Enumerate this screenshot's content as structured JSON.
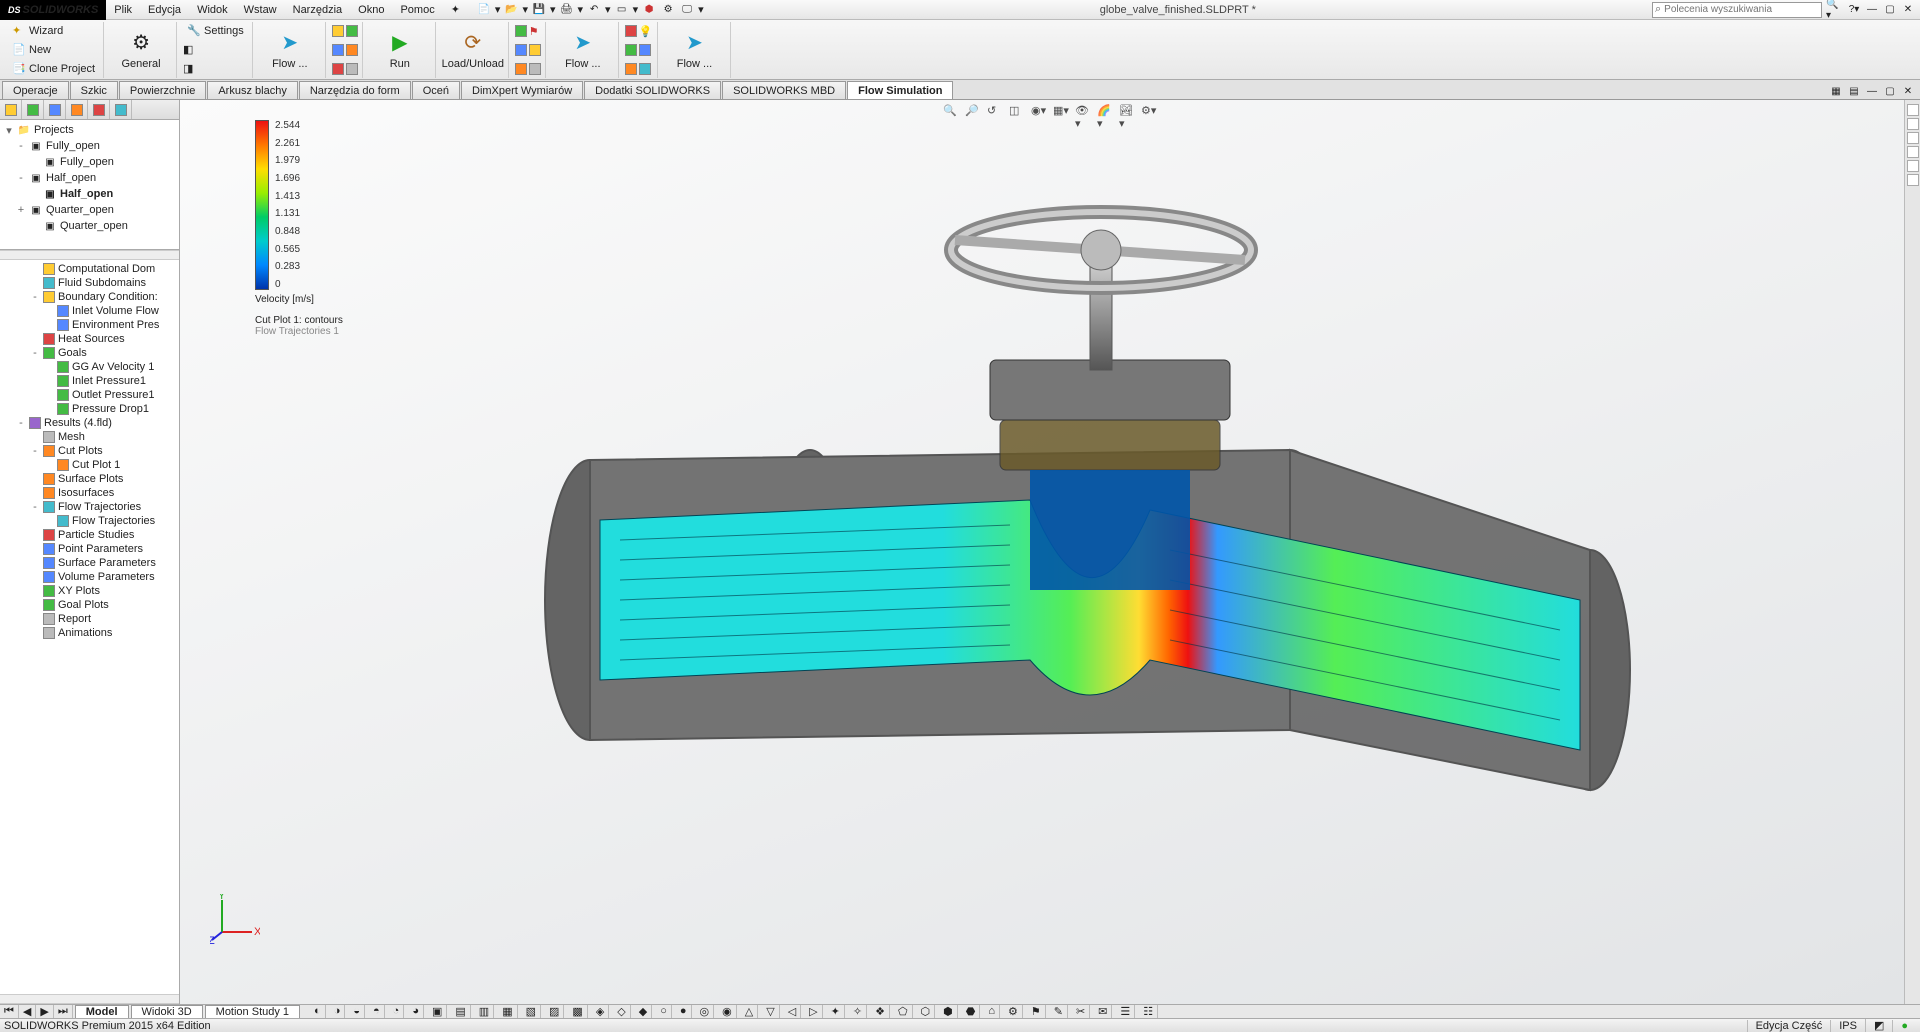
{
  "app": {
    "brand": "SOLIDWORKS",
    "title": "globe_valve_finished.SLDPRT *"
  },
  "menu": {
    "items": [
      "Plik",
      "Edycja",
      "Widok",
      "Wstaw",
      "Narzędzia",
      "Okno",
      "Pomoc"
    ]
  },
  "search": {
    "placeholder": "Polecenia wyszukiwania"
  },
  "ribbon": {
    "wizard": "Wizard",
    "new": "New",
    "clone": "Clone Project",
    "general": "General",
    "settings": "Settings",
    "flow": "Flow ...",
    "run": "Run",
    "loadunload": "Load/Unload",
    "flow2": "Flow ...",
    "flow3": "Flow ..."
  },
  "tabs": {
    "items": [
      "Operacje",
      "Szkic",
      "Powierzchnie",
      "Arkusz blachy",
      "Narzędzia do form",
      "Oceń",
      "DimXpert Wymiarów",
      "Dodatki SOLIDWORKS",
      "SOLIDWORKS MBD",
      "Flow Simulation"
    ],
    "active": 9
  },
  "tree1": {
    "root": "Projects",
    "items": [
      {
        "label": "Fully_open",
        "exp": "-",
        "lvl": 1
      },
      {
        "label": "Fully_open",
        "lvl": 2
      },
      {
        "label": "Half_open",
        "exp": "-",
        "lvl": 1
      },
      {
        "label": "Half_open",
        "lvl": 2,
        "bold": true
      },
      {
        "label": "Quarter_open",
        "exp": "+",
        "lvl": 1
      },
      {
        "label": "Quarter_open",
        "lvl": 2
      }
    ]
  },
  "tree2": {
    "items": [
      {
        "label": "Computational Dom",
        "lvl": 1,
        "ico": "c-yel"
      },
      {
        "label": "Fluid Subdomains",
        "lvl": 1,
        "ico": "c-cyan"
      },
      {
        "label": "Boundary Condition:",
        "lvl": 1,
        "exp": "-",
        "ico": "c-yel"
      },
      {
        "label": "Inlet Volume Flow",
        "lvl": 2,
        "ico": "c-blu"
      },
      {
        "label": "Environment Pres",
        "lvl": 2,
        "ico": "c-blu"
      },
      {
        "label": "Heat Sources",
        "lvl": 1,
        "ico": "c-red"
      },
      {
        "label": "Goals",
        "lvl": 1,
        "exp": "-",
        "ico": "c-grn"
      },
      {
        "label": "GG Av Velocity 1",
        "lvl": 2,
        "ico": "c-grn"
      },
      {
        "label": "Inlet Pressure1",
        "lvl": 2,
        "ico": "c-grn"
      },
      {
        "label": "Outlet Pressure1",
        "lvl": 2,
        "ico": "c-grn"
      },
      {
        "label": "Pressure Drop1",
        "lvl": 2,
        "ico": "c-grn"
      },
      {
        "label": "Results (4.fld)",
        "lvl": 0,
        "exp": "-",
        "ico": "c-purp"
      },
      {
        "label": "Mesh",
        "lvl": 1,
        "ico": "c-gray"
      },
      {
        "label": "Cut Plots",
        "lvl": 1,
        "exp": "-",
        "ico": "c-org"
      },
      {
        "label": "Cut Plot 1",
        "lvl": 2,
        "ico": "c-org"
      },
      {
        "label": "Surface Plots",
        "lvl": 1,
        "ico": "c-org"
      },
      {
        "label": "Isosurfaces",
        "lvl": 1,
        "ico": "c-org"
      },
      {
        "label": "Flow Trajectories",
        "lvl": 1,
        "exp": "-",
        "ico": "c-cyan"
      },
      {
        "label": "Flow Trajectories",
        "lvl": 2,
        "ico": "c-cyan"
      },
      {
        "label": "Particle Studies",
        "lvl": 1,
        "ico": "c-red"
      },
      {
        "label": "Point Parameters",
        "lvl": 1,
        "ico": "c-blu"
      },
      {
        "label": "Surface Parameters",
        "lvl": 1,
        "ico": "c-blu"
      },
      {
        "label": "Volume Parameters",
        "lvl": 1,
        "ico": "c-blu"
      },
      {
        "label": "XY Plots",
        "lvl": 1,
        "ico": "c-grn"
      },
      {
        "label": "Goal Plots",
        "lvl": 1,
        "ico": "c-grn"
      },
      {
        "label": "Report",
        "lvl": 1,
        "ico": "c-gray"
      },
      {
        "label": "Animations",
        "lvl": 1,
        "ico": "c-gray"
      }
    ]
  },
  "legend": {
    "ticks": [
      "2.544",
      "2.261",
      "1.979",
      "1.696",
      "1.413",
      "1.131",
      "0.848",
      "0.565",
      "0.283",
      "0"
    ],
    "title": "Velocity [m/s]",
    "sub1": "Cut Plot 1: contours",
    "sub2": "Flow Trajectories 1"
  },
  "bottom": {
    "tabs": [
      "Model",
      "Widoki 3D",
      "Motion Study 1"
    ]
  },
  "status": {
    "left": "SOLIDWORKS Premium 2015 x64 Edition",
    "edit": "Edycja Część",
    "units": "IPS"
  }
}
